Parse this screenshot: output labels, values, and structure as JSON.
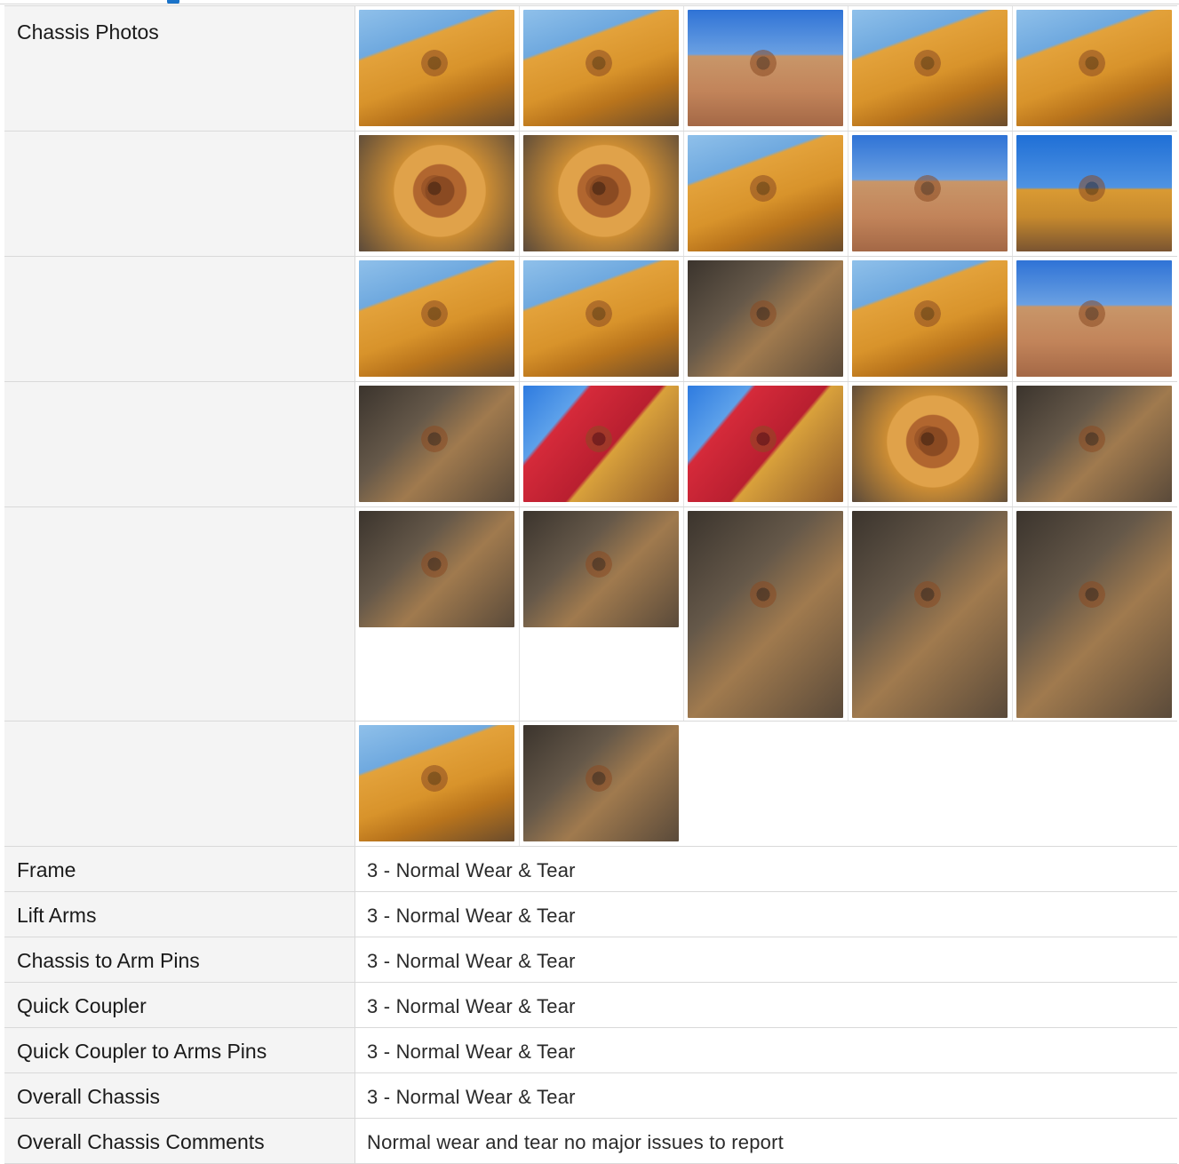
{
  "section_label": "Chassis Photos",
  "photos": [
    [
      "machine-side-view",
      "machine-rear-logo",
      "machine-front-view",
      "machine-top-view",
      "machine-track-side"
    ],
    [
      "arm-rust-closeup",
      "arm-rust-scale",
      "pivot-pin-rust",
      "arm-desert-view",
      "pin-bore-rust"
    ],
    [
      "arm-channel-rust",
      "logo-pin-rust",
      "arm-channel-dark",
      "logo-pin-closeup",
      "arm-desert-sky"
    ],
    [
      "pin-bore-black-plate",
      "red-arm-rust",
      "red-arm-pin",
      "dirt-buildup",
      "coupler-corner"
    ],
    [
      "coupler-pin-left",
      "coupler-pin-plate",
      "coupler-cylinder",
      "coupler-bore",
      "coupler-cylinder-2"
    ],
    [
      "coupler-arm-yellow",
      "coupler-linkage"
    ]
  ],
  "ratings": [
    {
      "label": "Frame",
      "value": "3 - Normal Wear & Tear"
    },
    {
      "label": "Lift Arms",
      "value": "3 - Normal Wear & Tear"
    },
    {
      "label": "Chassis to Arm Pins",
      "value": "3 - Normal Wear & Tear"
    },
    {
      "label": "Quick Coupler",
      "value": "3 - Normal Wear & Tear"
    },
    {
      "label": "Quick Coupler to Arms Pins",
      "value": "3 - Normal Wear & Tear"
    },
    {
      "label": "Overall Chassis",
      "value": "3 - Normal Wear & Tear"
    },
    {
      "label": "Overall Chassis Comments",
      "value": "Normal wear and tear no major issues to report"
    }
  ]
}
